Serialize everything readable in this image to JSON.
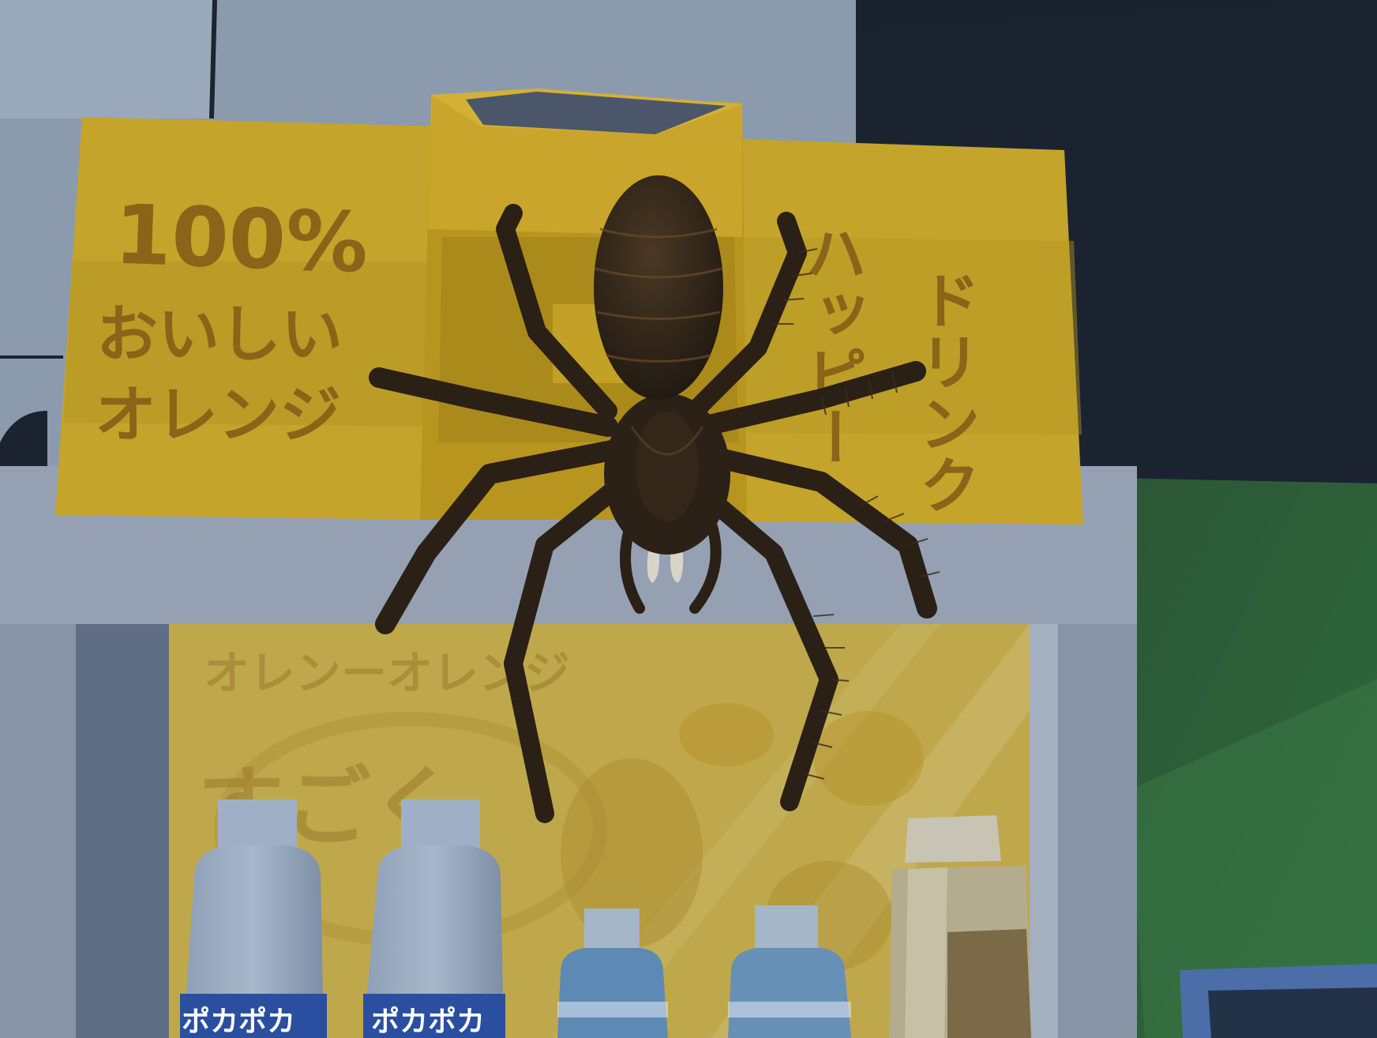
{
  "scene": {
    "title": "",
    "colors": {
      "night_sky": "#1b2331",
      "wall": "#8d9cb0",
      "vending_body": "#8b97a8",
      "sign_yellow": "#c8a62c",
      "grass": "#2e5a38",
      "spider": "#2a2118"
    }
  },
  "left_sign": {
    "line1": "100%",
    "line2": "おいしい",
    "line3": "オレンジ"
  },
  "right_sign": {
    "col1": "ハッピー",
    "col2": "ドリンク"
  },
  "display_window": {
    "headline": "オレンーオレンジ",
    "large_text": "すごく"
  },
  "bottles": [
    {
      "label": "ポカポカ"
    },
    {
      "label": "ポカポカ"
    }
  ],
  "creature": {
    "name": "spider-icon"
  }
}
